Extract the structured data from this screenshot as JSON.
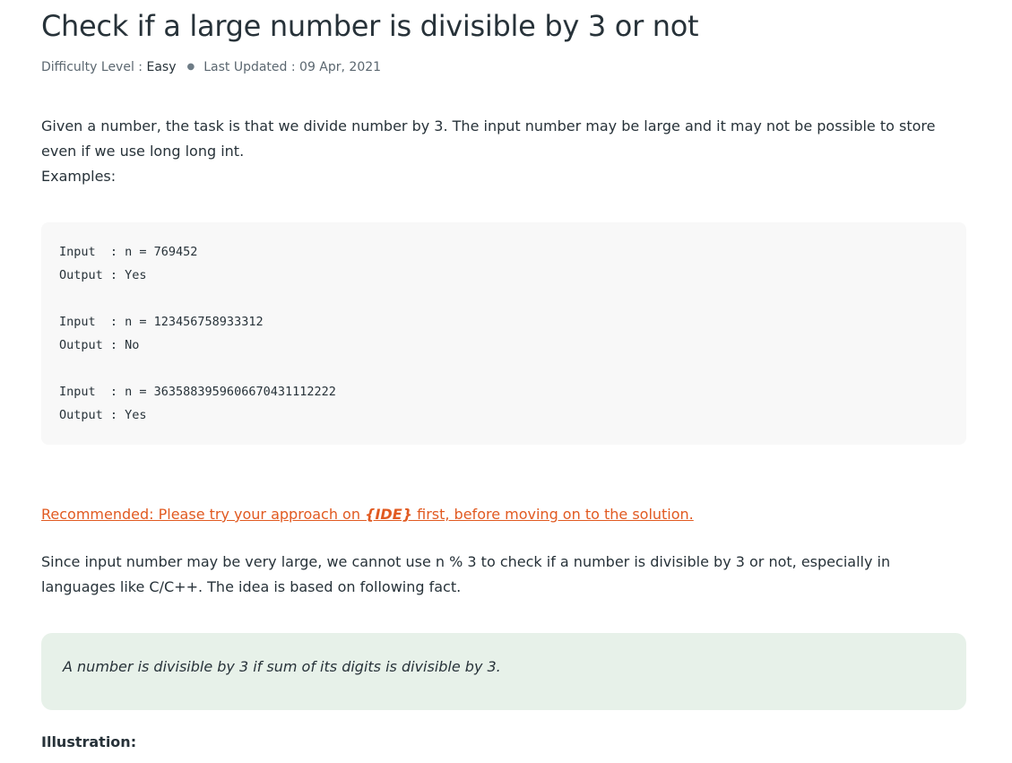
{
  "article": {
    "title": "Check if a large number is divisible by 3 or not",
    "meta": {
      "difficulty_label": "Difficulty Level : ",
      "difficulty_value": "Easy",
      "updated_label": "Last Updated : 09 Apr, 2021"
    },
    "intro_line1": "Given a number, the task is that we divide number by 3. The input number may be large and it may not be possible to store even if we use long long int.",
    "intro_line2": "Examples:",
    "examples": [
      {
        "input": "Input  : n = 769452",
        "output": "Output : Yes"
      },
      {
        "input": "Input  : n = 123456758933312",
        "output": "Output : No"
      },
      {
        "input": "Input  : n = 3635883959606670431112222",
        "output": "Output : Yes"
      }
    ],
    "recommended": {
      "prefix": "Recommended: Please try your approach on ",
      "ide": "{IDE}",
      "suffix": " first, before moving on to the solution."
    },
    "explanation": "Since input number may be very large, we cannot use n % 3 to check if a number is divisible by 3 or not, especially in languages like C/C++. The idea is based on following fact.",
    "fact": "A number is divisible by 3 if sum of its digits is divisible by 3.",
    "illustration_label": "Illustration:"
  }
}
